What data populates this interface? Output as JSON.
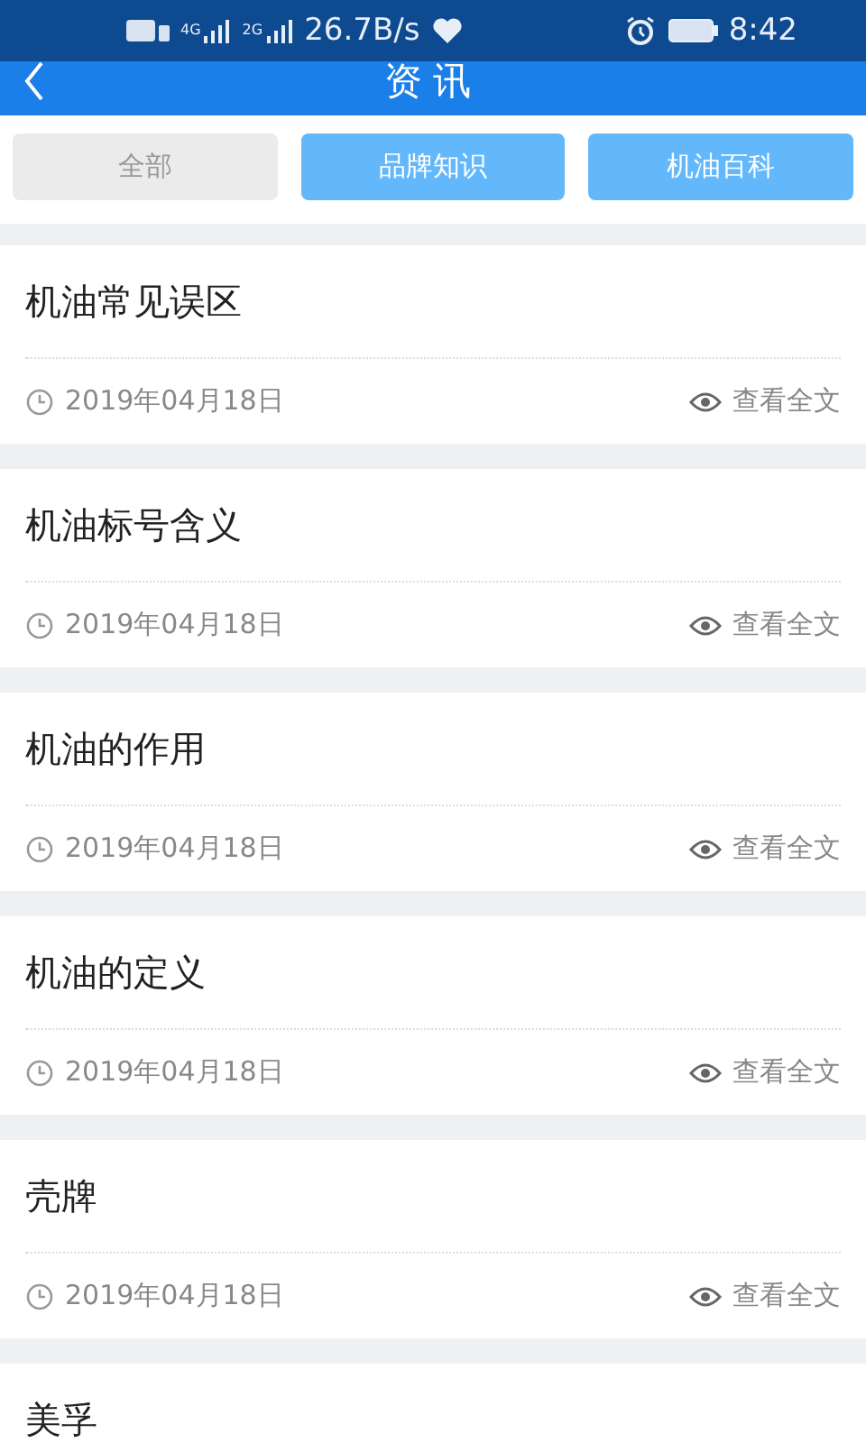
{
  "status_bar": {
    "networks": [
      "4G",
      "2G"
    ],
    "speed": "26.7B/s",
    "time": "8:42"
  },
  "header": {
    "title": "资讯"
  },
  "tabs": [
    {
      "label": "全部",
      "selected": true
    },
    {
      "label": "品牌知识",
      "selected": false
    },
    {
      "label": "机油百科",
      "selected": false
    }
  ],
  "articles": [
    {
      "title": "机油常见误区",
      "date": "2019年04月18日",
      "action": "查看全文"
    },
    {
      "title": "机油标号含义",
      "date": "2019年04月18日",
      "action": "查看全文"
    },
    {
      "title": "机油的作用",
      "date": "2019年04月18日",
      "action": "查看全文"
    },
    {
      "title": "机油的定义",
      "date": "2019年04月18日",
      "action": "查看全文"
    },
    {
      "title": "壳牌",
      "date": "2019年04月18日",
      "action": "查看全文"
    },
    {
      "title": "美孚"
    }
  ]
}
